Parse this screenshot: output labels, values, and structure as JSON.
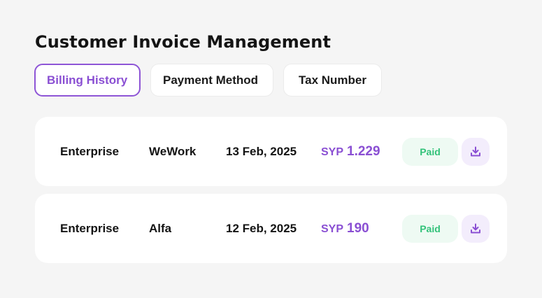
{
  "page": {
    "title": "Customer Invoice Management"
  },
  "tabs": [
    {
      "label": "Billing History",
      "active": true
    },
    {
      "label": "Payment Method",
      "active": false
    },
    {
      "label": "Tax Number",
      "active": false
    }
  ],
  "invoices": [
    {
      "plan": "Enterprise",
      "company": "WeWork",
      "date": "13 Feb, 2025",
      "currency": "SYP",
      "amount": "1.229",
      "status": "Paid"
    },
    {
      "plan": "Enterprise",
      "company": "Alfa",
      "date": "12 Feb, 2025",
      "currency": "SYP",
      "amount": "190",
      "status": "Paid"
    }
  ],
  "icons": {
    "download": "download-icon"
  },
  "colors": {
    "accent": "#8a4fd3",
    "paid_text": "#33c27a",
    "paid_bg": "#eefaf3",
    "download_bg": "#f3edfc"
  }
}
